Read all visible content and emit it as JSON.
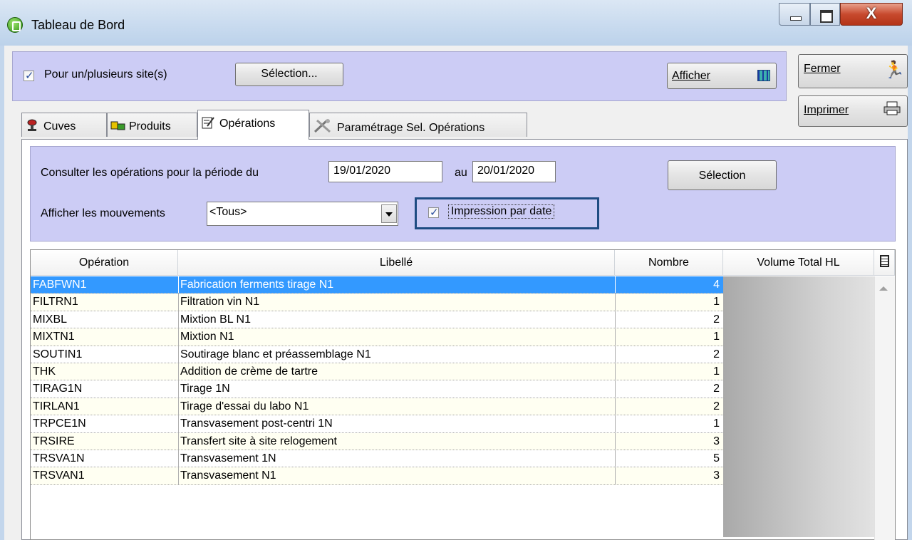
{
  "window": {
    "title": "Tableau de Bord"
  },
  "top": {
    "sites_label": "Pour un/plusieurs site(s)",
    "sites_checked": true,
    "selection_label": "Sélection...",
    "afficher_label": "Afficher",
    "fermer_label": "Fermer",
    "imprimer_label": "Imprimer",
    "check_mark": "✓",
    "fermer_icon": "running-man-icon",
    "imprimer_icon": "printer-icon"
  },
  "tabs": [
    {
      "label": "Cuves",
      "icon": "vat-icon",
      "active": false
    },
    {
      "label": "Produits",
      "icon": "products-icon",
      "active": false
    },
    {
      "label": "Opérations",
      "icon": "notepad-icon",
      "active": true
    },
    {
      "label": "Paramétrage Sel. Opérations",
      "icon": "tools-icon",
      "active": false
    }
  ],
  "filters": {
    "period_label": "Consulter les opérations pour la période du",
    "date_from": "19/01/2020",
    "au_label": "au",
    "date_to": "20/01/2020",
    "selection_label": "Sélection",
    "mouvements_label": "Afficher les mouvements",
    "mouvements_value": "<Tous>",
    "impression_label": "Impression par date",
    "impression_checked": true
  },
  "table": {
    "columns": [
      "Opération",
      "Libellé",
      "Nombre",
      "Volume Total HL"
    ],
    "selected_index": 0,
    "rows": [
      {
        "op": "FABFWN1",
        "lib": "Fabrication ferments tirage N1",
        "nb": "4"
      },
      {
        "op": "FILTRN1",
        "lib": "Filtration vin N1",
        "nb": "1"
      },
      {
        "op": "MIXBL",
        "lib": "Mixtion BL N1",
        "nb": "2"
      },
      {
        "op": "MIXTN1",
        "lib": "Mixtion N1",
        "nb": "1"
      },
      {
        "op": "SOUTIN1",
        "lib": "Soutirage blanc et préassemblage N1",
        "nb": "2"
      },
      {
        "op": "THK",
        "lib": "Addition de crème de tartre",
        "nb": "1"
      },
      {
        "op": "TIRAG1N",
        "lib": "Tirage 1N",
        "nb": "2"
      },
      {
        "op": "TIRLAN1",
        "lib": "Tirage d'essai du labo N1",
        "nb": "2"
      },
      {
        "op": "TRPCE1N",
        "lib": "Transvasement post-centri 1N",
        "nb": "1"
      },
      {
        "op": "TRSIRE",
        "lib": "Transfert site à site relogement",
        "nb": "3"
      },
      {
        "op": "TRSVA1N",
        "lib": "Transvasement 1N",
        "nb": "5"
      },
      {
        "op": "TRSVAN1",
        "lib": "Transvasement N1",
        "nb": "3"
      }
    ]
  },
  "colors": {
    "band": "#ccccf5",
    "selection": "#3399ff",
    "highlight_box": "#1e4c82",
    "row_alt": "#fffff2"
  }
}
